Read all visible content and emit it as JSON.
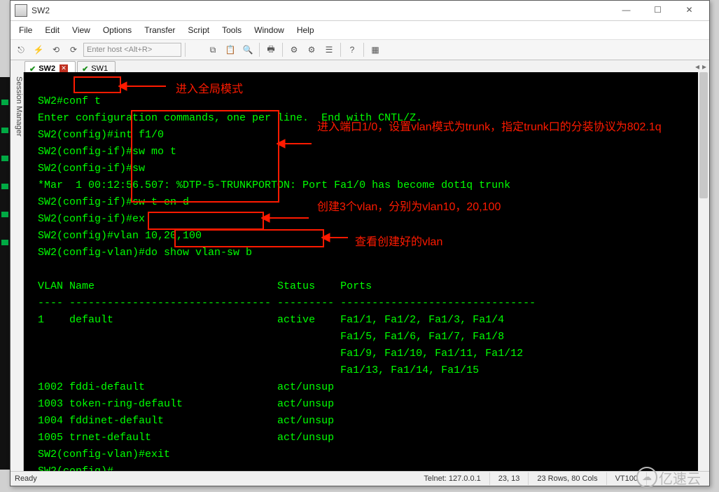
{
  "window": {
    "title": "SW2"
  },
  "window_controls": {
    "min": "—",
    "max": "☐",
    "close": "✕"
  },
  "menu": [
    "File",
    "Edit",
    "View",
    "Options",
    "Transfer",
    "Script",
    "Tools",
    "Window",
    "Help"
  ],
  "toolbar": {
    "host_placeholder": "Enter host <Alt+R>",
    "icons": [
      "reconnect",
      "quick",
      "copy-session",
      "reconnect-all",
      "paste",
      "copy",
      "find",
      "print",
      "settings",
      "global-opts",
      "serial",
      "hex",
      "help",
      "script"
    ]
  },
  "tabs": [
    {
      "label": "SW2",
      "active": true,
      "modified": true
    },
    {
      "label": "SW1",
      "active": false,
      "modified": false
    }
  ],
  "sidebar_label": "Session Manager",
  "terminal": {
    "lines": [
      "SW2#conf t",
      "Enter configuration commands, one per line.  End with CNTL/Z.",
      "SW2(config)#int f1/0",
      "SW2(config-if)#sw mo t",
      "SW2(config-if)#sw",
      "*Mar  1 00:12:56.507: %DTP-5-TRUNKPORTON: Port Fa1/0 has become dot1q trunk",
      "SW2(config-if)#sw t en d",
      "SW2(config-if)#ex",
      "SW2(config)#vlan 10,20,100",
      "SW2(config-vlan)#do show vlan-sw b",
      "",
      "VLAN Name                             Status    Ports",
      "---- -------------------------------- --------- -------------------------------",
      "1    default                          active    Fa1/1, Fa1/2, Fa1/3, Fa1/4",
      "                                                Fa1/5, Fa1/6, Fa1/7, Fa1/8",
      "                                                Fa1/9, Fa1/10, Fa1/11, Fa1/12",
      "                                                Fa1/13, Fa1/14, Fa1/15",
      "1002 fddi-default                     act/unsup",
      "1003 token-ring-default               act/unsup",
      "1004 fddinet-default                  act/unsup",
      "1005 trnet-default                    act/unsup",
      "SW2(config-vlan)#exit",
      "SW2(config)#"
    ]
  },
  "annotations": {
    "a1": "进入全局模式",
    "a2": "进入端口1/0，设置vlan模式为trunk，指定trunk口的分装协议为802.1q",
    "a3": "创建3个vlan，分别为vlan10，20,100",
    "a4": "查看创建好的vlan"
  },
  "status": {
    "ready": "Ready",
    "conn": "Telnet: 127.0.0.1",
    "pos": "23,  13",
    "size": "23 Rows, 80 Cols",
    "term": "VT100"
  },
  "watermark": "亿速云"
}
